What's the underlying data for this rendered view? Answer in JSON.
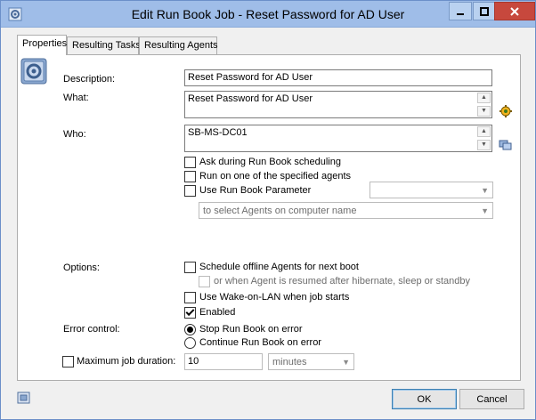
{
  "window": {
    "title": "Edit Run Book Job - Reset Password for AD User",
    "title_icon": "gear-window-icon",
    "controls": [
      "minimize",
      "maximize",
      "close"
    ]
  },
  "tabs": [
    {
      "label": "Properties",
      "active": true
    },
    {
      "label": "Resulting Tasks",
      "active": false
    },
    {
      "label": "Resulting Agents",
      "active": false
    }
  ],
  "form": {
    "description_label": "Description:",
    "description_value": "Reset Password for AD User",
    "what_label": "What:",
    "what_value": "Reset Password for AD User",
    "who_label": "Who:",
    "who_value": "SB-MS-DC01",
    "ask_during_label": "Ask during Run Book scheduling",
    "run_on_agent_label": "Run on one of the specified agents",
    "use_param_label": "Use Run Book Parameter",
    "param_combo_value": "",
    "agents_combo_placeholder": "to select Agents on computer name",
    "options_label": "Options:",
    "schedule_offline_label": "Schedule offline Agents for next boot",
    "or_when_resumed_label": "or when Agent is resumed after hibernate, sleep or standby",
    "wake_on_lan_label": "Use Wake-on-LAN when job starts",
    "enabled_label": "Enabled",
    "enabled_checked": true,
    "error_control_label": "Error control:",
    "stop_on_error_label": "Stop Run Book on error",
    "continue_on_error_label": "Continue Run Book on error",
    "stop_selected": true,
    "max_duration_label": "Maximum job duration:",
    "max_duration_value": "10",
    "duration_unit": "minutes"
  },
  "buttons": {
    "ok": "OK",
    "cancel": "Cancel"
  },
  "colors": {
    "titlebar": "#9fbde8",
    "close_button": "#c7483d",
    "panel_bg": "#ffffff",
    "dialog_bg": "#f0f0f0"
  }
}
